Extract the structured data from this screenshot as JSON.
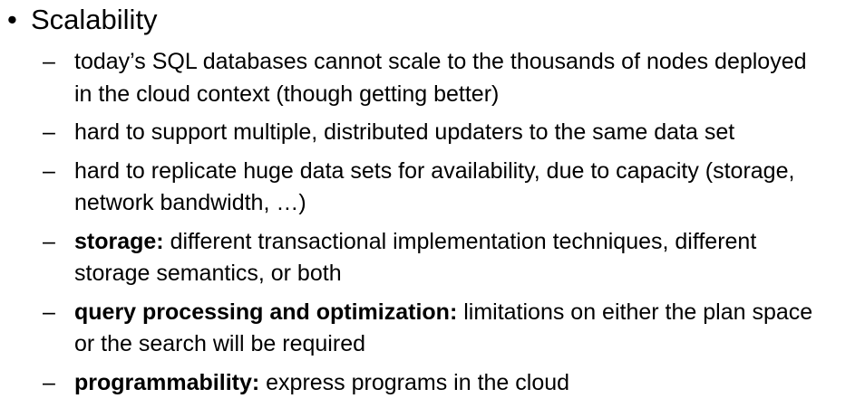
{
  "heading": {
    "bullet": "•",
    "title": "Scalability"
  },
  "items": [
    {
      "dash": "–",
      "bold": "",
      "line1": "today’s SQL databases cannot scale to the thousands of nodes deployed",
      "line2": "in the cloud context (though getting better)"
    },
    {
      "dash": "–",
      "bold": "",
      "line1": "hard to support multiple, distributed updaters to the same data set",
      "line2": ""
    },
    {
      "dash": "–",
      "bold": "",
      "line1": "hard to replicate huge data sets for availability, due to capacity (storage,",
      "line2": "network bandwidth, …)"
    },
    {
      "dash": "–",
      "bold": "storage:",
      "line1": " different transactional implementation techniques, different",
      "line2": "storage semantics, or both"
    },
    {
      "dash": "–",
      "bold": "query processing and optimization:",
      "line1": " limitations on either the plan space",
      "line2": "or the search will be required"
    },
    {
      "dash": "–",
      "bold": "programmability:",
      "line1": " express programs in the cloud",
      "line2": ""
    }
  ]
}
